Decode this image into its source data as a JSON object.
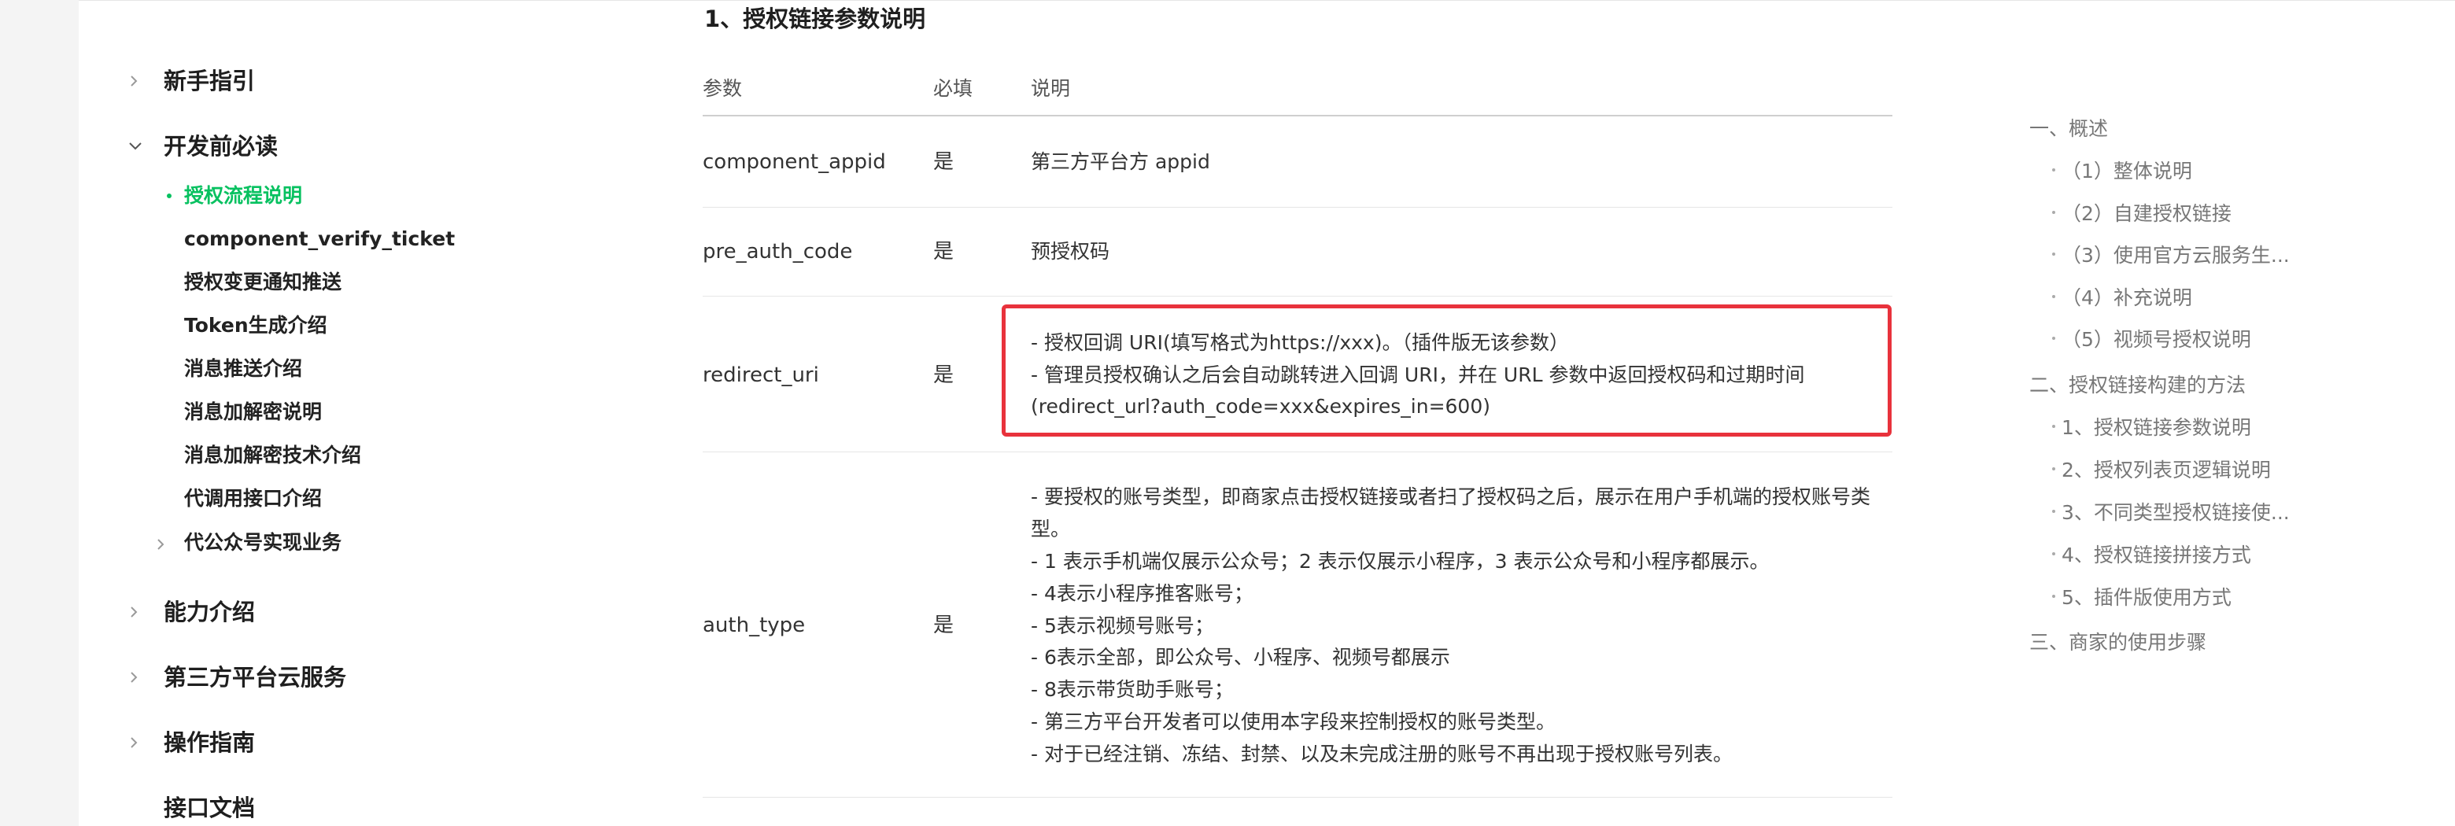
{
  "sidebar": {
    "items": [
      {
        "label": "新手指引",
        "expanded": false
      },
      {
        "label": "开发前必读",
        "expanded": true
      },
      {
        "label": "能力介绍",
        "expanded": false
      },
      {
        "label": "第三方平台云服务",
        "expanded": false
      },
      {
        "label": "操作指南",
        "expanded": false
      },
      {
        "label": "接口文档",
        "expanded": false
      }
    ],
    "subitems": [
      {
        "label": "授权流程说明",
        "active": true
      },
      {
        "label": "component_verify_ticket"
      },
      {
        "label": "授权变更通知推送"
      },
      {
        "label": "Token生成介绍"
      },
      {
        "label": "消息推送介绍"
      },
      {
        "label": "消息加解密说明"
      },
      {
        "label": "消息加解密技术介绍"
      },
      {
        "label": "代调用接口介绍"
      },
      {
        "label": "代公众号实现业务"
      }
    ]
  },
  "main": {
    "section_title": "1、授权链接参数说明",
    "table": {
      "headers": [
        "参数",
        "必填",
        "说明"
      ],
      "rows": [
        {
          "param": "component_appid",
          "required": "是",
          "desc": [
            "第三方平台方 appid"
          ]
        },
        {
          "param": "pre_auth_code",
          "required": "是",
          "desc": [
            "预授权码"
          ]
        },
        {
          "param": "redirect_uri",
          "required": "是",
          "desc": [
            "- 授权回调 URI(填写格式为https://xxx)。（插件版无该参数）",
            "- 管理员授权确认之后会自动跳转进入回调 URI，并在 URL 参数中返回授权码和过期时间",
            "(redirect_url?auth_code=xxx&expires_in=600)"
          ]
        },
        {
          "param": "auth_type",
          "required": "是",
          "desc": [
            "- 要授权的账号类型，即商家点击授权链接或者扫了授权码之后，展示在用户手机端的授权账号类",
            "型。",
            "- 1 表示手机端仅展示公众号；2 表示仅展示小程序，3 表示公众号和小程序都展示。",
            "- 4表示小程序推客账号；",
            "- 5表示视频号账号；",
            "- 6表示全部，即公众号、小程序、视频号都展示",
            "- 8表示带货助手账号；",
            "- 第三方平台开发者可以使用本字段来控制授权的账号类型。",
            "- 对于已经注销、冻结、封禁、以及未完成注册的账号不再出现于授权账号列表。"
          ]
        }
      ]
    }
  },
  "toc": {
    "items": [
      {
        "label": "一、概述",
        "level": 1
      },
      {
        "label": "（1）整体说明",
        "level": 2
      },
      {
        "label": "（2）自建授权链接",
        "level": 2
      },
      {
        "label": "（3）使用官方云服务生...",
        "level": 2
      },
      {
        "label": "（4）补充说明",
        "level": 2
      },
      {
        "label": "（5）视频号授权说明",
        "level": 2
      },
      {
        "label": "二、授权链接构建的方法",
        "level": 1
      },
      {
        "label": "1、授权链接参数说明",
        "level": 2
      },
      {
        "label": "2、授权列表页逻辑说明",
        "level": 2
      },
      {
        "label": "3、不同类型授权链接使...",
        "level": 2
      },
      {
        "label": "4、授权链接拼接方式",
        "level": 2
      },
      {
        "label": "5、插件版使用方式",
        "level": 2
      },
      {
        "label": "三、商家的使用步骤",
        "level": 1
      }
    ]
  },
  "colors": {
    "active_green": "#07c160",
    "highlight_red": "#e8323c"
  }
}
